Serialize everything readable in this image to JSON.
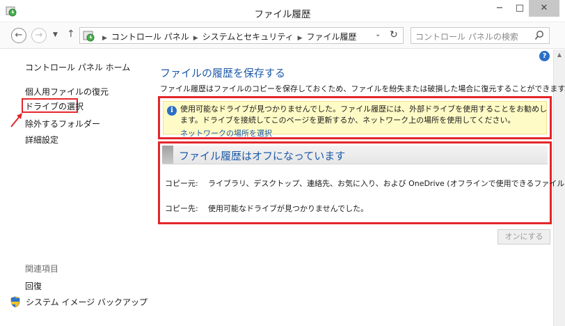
{
  "window": {
    "title": "ファイル履歴",
    "minimize": "−",
    "maximize": "□",
    "close": "✕"
  },
  "address": {
    "crumbs": [
      "コントロール パネル",
      "システムとセキュリティ",
      "ファイル履歴"
    ],
    "search_placeholder": "コントロール パネルの検索"
  },
  "sidebar": {
    "home": "コントロール パネル ホーム",
    "items": [
      "個人用ファイルの復元",
      "ドライブの選択",
      "除外するフォルダー",
      "詳細設定"
    ],
    "related_heading": "関連項目",
    "related": [
      "回復",
      "システム イメージ バックアップ"
    ]
  },
  "main": {
    "title": "ファイルの履歴を保存する",
    "description": "ファイル履歴はファイルのコピーを保存しておくため、ファイルを紛失または破損した場合に復元することができます。",
    "notice": {
      "text": "使用可能なドライブが見つかりませんでした。ファイル履歴には、外部ドライブを使用することをお勧めします。ドライブを接続してこのページを更新するか、ネットワーク上の場所を使用してください。",
      "link": "ネットワークの場所を選択"
    },
    "status": {
      "title": "ファイル履歴はオフになっています",
      "copy_from_label": "コピー元:",
      "copy_from_value": "ライブラリ、デスクトップ、連絡先、お気に入り、および OneDrive (オフラインで使用できるファイルのみ)",
      "copy_to_label": "コピー先:",
      "copy_to_value": "使用可能なドライブが見つかりませんでした。"
    },
    "turn_on_button": "オンにする"
  },
  "colors": {
    "accent_blue": "#1d5aa8",
    "highlight_red": "#e3262a",
    "notice_yellow": "#fffbc6"
  }
}
